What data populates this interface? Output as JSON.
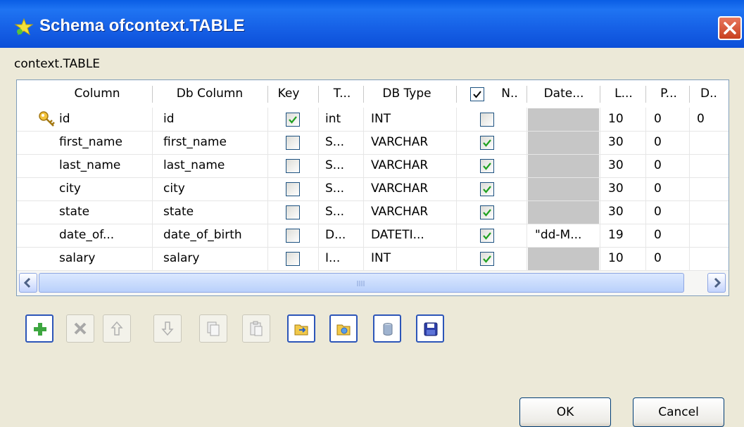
{
  "window": {
    "title": "Schema ofcontext.TABLE"
  },
  "schema_label": "context.TABLE",
  "table": {
    "headers": [
      "Column",
      "Db Column",
      "Key",
      "T...",
      "DB Type",
      "N..",
      "Date...",
      "L...",
      "P...",
      "D.."
    ],
    "rows": [
      {
        "key_icon": true,
        "column": "id",
        "db_column": "id",
        "key": true,
        "type": "int",
        "db_type": "INT",
        "nullable": false,
        "date": "",
        "date_grey": true,
        "length": "10",
        "precision": "0",
        "default": "0"
      },
      {
        "key_icon": false,
        "column": "first_name",
        "db_column": "first_name",
        "key": false,
        "type": "S...",
        "db_type": "VARCHAR",
        "nullable": true,
        "date": "",
        "date_grey": true,
        "length": "30",
        "precision": "0",
        "default": ""
      },
      {
        "key_icon": false,
        "column": "last_name",
        "db_column": "last_name",
        "key": false,
        "type": "S...",
        "db_type": "VARCHAR",
        "nullable": true,
        "date": "",
        "date_grey": true,
        "length": "30",
        "precision": "0",
        "default": ""
      },
      {
        "key_icon": false,
        "column": "city",
        "db_column": "city",
        "key": false,
        "type": "S...",
        "db_type": "VARCHAR",
        "nullable": true,
        "date": "",
        "date_grey": true,
        "length": "30",
        "precision": "0",
        "default": ""
      },
      {
        "key_icon": false,
        "column": "state",
        "db_column": "state",
        "key": false,
        "type": "S...",
        "db_type": "VARCHAR",
        "nullable": true,
        "date": "",
        "date_grey": true,
        "length": "30",
        "precision": "0",
        "default": ""
      },
      {
        "key_icon": false,
        "column": "date_of...",
        "db_column": "date_of_birth",
        "key": false,
        "type": "D...",
        "db_type": "DATETI...",
        "nullable": true,
        "date": "\"dd-M...",
        "date_grey": false,
        "length": "19",
        "precision": "0",
        "default": ""
      },
      {
        "key_icon": false,
        "column": "salary",
        "db_column": "salary",
        "key": false,
        "type": "I...",
        "db_type": "INT",
        "nullable": true,
        "date": "",
        "date_grey": true,
        "length": "10",
        "precision": "0",
        "default": ""
      }
    ]
  },
  "toolbar": {
    "buttons": [
      {
        "name": "add-icon",
        "enabled": true
      },
      {
        "name": "delete-icon",
        "enabled": false
      },
      {
        "name": "move-up-icon",
        "enabled": false
      },
      {
        "name": "move-down-icon",
        "enabled": false
      },
      {
        "name": "copy-icon",
        "enabled": false
      },
      {
        "name": "paste-icon",
        "enabled": false
      },
      {
        "name": "import-schema-icon",
        "enabled": true
      },
      {
        "name": "export-schema-icon",
        "enabled": true
      },
      {
        "name": "database-icon",
        "enabled": true
      },
      {
        "name": "save-icon",
        "enabled": true
      }
    ]
  },
  "buttons": {
    "ok": "OK",
    "cancel": "Cancel"
  }
}
